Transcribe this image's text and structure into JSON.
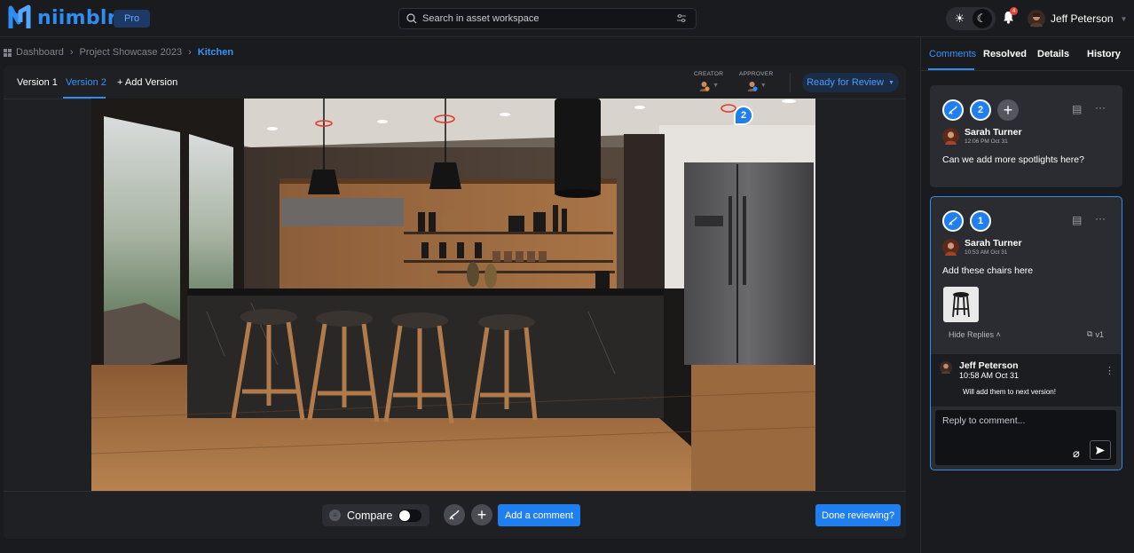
{
  "app": {
    "name": "niimblr",
    "plan_badge": "Pro",
    "brand_color": "#2f8cf1"
  },
  "search": {
    "placeholder": "Search in asset workspace"
  },
  "user": {
    "name": "Jeff Peterson",
    "notification_count": "4"
  },
  "breadcrumb": {
    "items": [
      "Dashboard",
      "Project Showcase 2023",
      "Kitchen"
    ]
  },
  "viewer": {
    "tabs": [
      "Version 1",
      "Version 2",
      "+ Add Version"
    ],
    "active_tab": "Version 2",
    "creator_label": "CREATOR",
    "approver_label": "APPROVER",
    "status": "Ready for Review",
    "annotation_pin": "2",
    "compare_label": "Compare",
    "compare_enabled": false,
    "add_comment_label": "Add a comment",
    "done_label": "Done reviewing?"
  },
  "panel": {
    "tabs": [
      "Comments",
      "Resolved",
      "Details",
      "History"
    ],
    "active_tab": "Comments",
    "comments": [
      {
        "number": "2",
        "author": "Sarah Turner",
        "time": "12:06 PM Oct 31",
        "text": "Can we add more spotlights here?"
      },
      {
        "number": "1",
        "author": "Sarah Turner",
        "time": "10:53 AM Oct 31",
        "text": "Add these chairs here",
        "hide_replies_label": "Hide Replies",
        "version": "v1",
        "replies": [
          {
            "author": "Jeff Peterson",
            "time": "10:58 AM Oct 31",
            "text": "Will add them to next version!"
          }
        ],
        "reply_placeholder": "Reply to comment..."
      }
    ]
  }
}
